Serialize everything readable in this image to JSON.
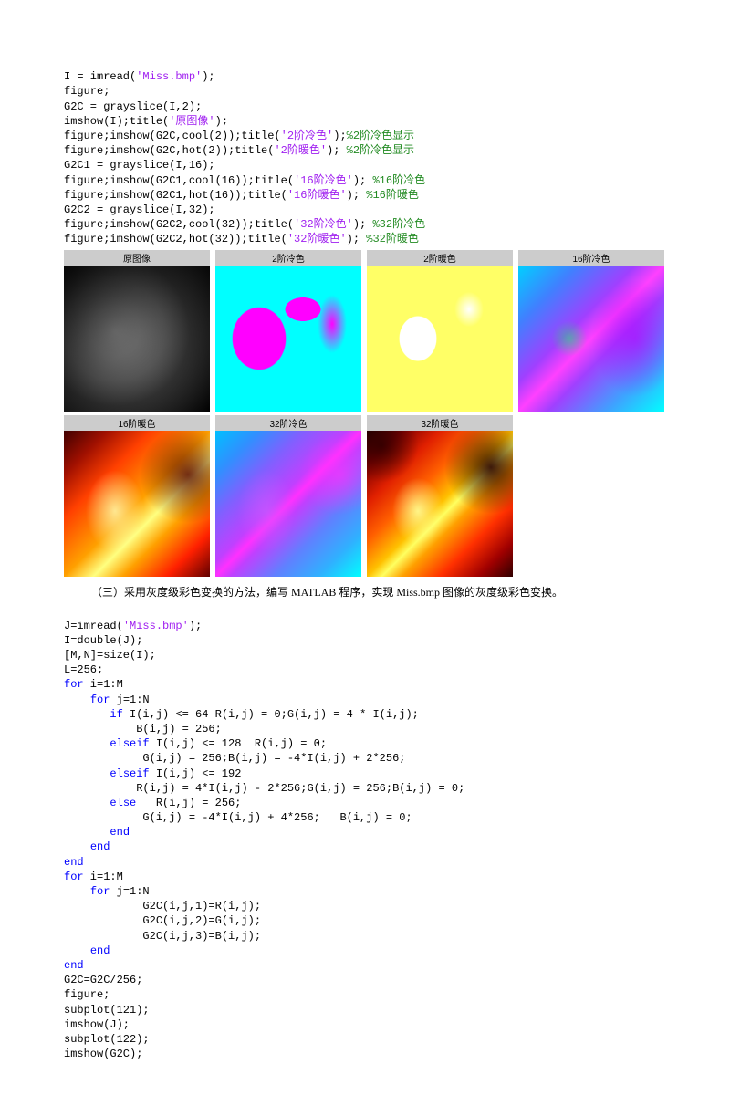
{
  "code1": {
    "l1": {
      "a": "I = imread(",
      "b": "'Miss.bmp'",
      "c": ");"
    },
    "l2": "figure;",
    "l3": "G2C = grayslice(I,2);",
    "l4": {
      "a": "imshow(I);title(",
      "b": "'原图像'",
      "c": ");"
    },
    "l5": {
      "a": "figure;imshow(G2C,cool(2));title(",
      "b": "'2阶冷色'",
      "c": ");",
      "d": "%2阶冷色显示"
    },
    "l6": {
      "a": "figure;imshow(G2C,hot(2));title(",
      "b": "'2阶暖色'",
      "c": "); ",
      "d": "%2阶冷色显示"
    },
    "l7": "G2C1 = grayslice(I,16);",
    "l8": {
      "a": "figure;imshow(G2C1,cool(16));title(",
      "b": "'16阶冷色'",
      "c": "); ",
      "d": "%16阶冷色"
    },
    "l9": {
      "a": "figure;imshow(G2C1,hot(16));title(",
      "b": "'16阶暖色'",
      "c": "); ",
      "d": "%16阶暖色"
    },
    "l10": "G2C2 = grayslice(I,32);",
    "l11": {
      "a": "figure;imshow(G2C2,cool(32));title(",
      "b": "'32阶冷色'",
      "c": "); ",
      "d": "%32阶冷色"
    },
    "l12": {
      "a": "figure;imshow(G2C2,hot(32));title(",
      "b": "'32阶暖色'",
      "c": "); ",
      "d": "%32阶暖色"
    }
  },
  "img_titles": {
    "t1": "原图像",
    "t2": "2阶冷色",
    "t3": "2阶暖色",
    "t4": "16阶冷色",
    "t5": "16阶暖色",
    "t6": "32阶冷色",
    "t7": "32阶暖色"
  },
  "caption": "（三）采用灰度级彩色变换的方法，编写 MATLAB 程序，实现 Miss.bmp 图像的灰度级彩色变换。",
  "code2": {
    "l1": {
      "a": "J=imread(",
      "b": "'Miss.bmp'",
      "c": ");"
    },
    "l2": "I=double(J);",
    "l3": "[M,N]=size(I);",
    "l4": "L=256;",
    "l5": {
      "k": "for",
      "r": " i=1:M"
    },
    "l6": {
      "k": "for",
      "r": " j=1:N"
    },
    "l7": {
      "k": "if",
      "r": " I(i,j) <= 64 R(i,j) = 0;G(i,j) = 4 * I(i,j);"
    },
    "l8": "B(i,j) = 256;",
    "l9": {
      "k": "elseif",
      "r": " I(i,j) <= 128  R(i,j) = 0;"
    },
    "l10": "G(i,j) = 256;B(i,j) = -4*I(i,j) + 2*256;",
    "l11": {
      "k": "elseif",
      "r": " I(i,j) <= 192"
    },
    "l12": "R(i,j) = 4*I(i,j) - 2*256;G(i,j) = 256;B(i,j) = 0;",
    "l13": {
      "k": "else",
      "r": "   R(i,j) = 256;"
    },
    "l14": "G(i,j) = -4*I(i,j) + 4*256;   B(i,j) = 0;",
    "l15": {
      "k": "end"
    },
    "l16": {
      "k": "end"
    },
    "l17": {
      "k": "end"
    },
    "l18": {
      "k": "for",
      "r": " i=1:M"
    },
    "l19": {
      "k": "for",
      "r": " j=1:N"
    },
    "l20": "G2C(i,j,1)=R(i,j);",
    "l21": "G2C(i,j,2)=G(i,j);",
    "l22": "G2C(i,j,3)=B(i,j);",
    "l23": {
      "k": "end"
    },
    "l24": {
      "k": "end"
    },
    "l25": "G2C=G2C/256;",
    "l26": "figure;",
    "l27": "subplot(121);",
    "l28": "imshow(J);",
    "l29": "subplot(122);",
    "l30": "imshow(G2C);"
  }
}
